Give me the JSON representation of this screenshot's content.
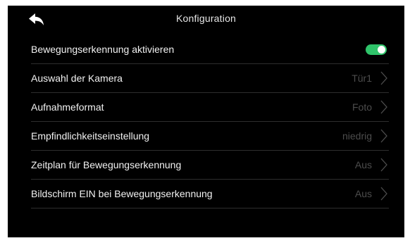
{
  "header": {
    "title": "Konfiguration"
  },
  "icons": {
    "back": "back-arrow-icon",
    "chevron": "chevron-right-icon"
  },
  "colors": {
    "background": "#000000",
    "toggle_on": "#2fc46a",
    "value_text": "#4d4d4d",
    "divider": "#2e2e2e"
  },
  "settings": [
    {
      "label": "Bewegungserkennung aktivieren",
      "type": "toggle",
      "on": true
    },
    {
      "label": "Auswahl der Kamera",
      "value": "Tür1"
    },
    {
      "label": "Aufnahmeformat",
      "value": "Foto"
    },
    {
      "label": "Empfindlichkeitseinstellung",
      "value": "niedrig"
    },
    {
      "label": "Zeitplan für Bewegungserkennung",
      "value": "Aus"
    },
    {
      "label": "Bildschirm EIN bei Bewegungserkennung",
      "value": "Aus"
    }
  ]
}
